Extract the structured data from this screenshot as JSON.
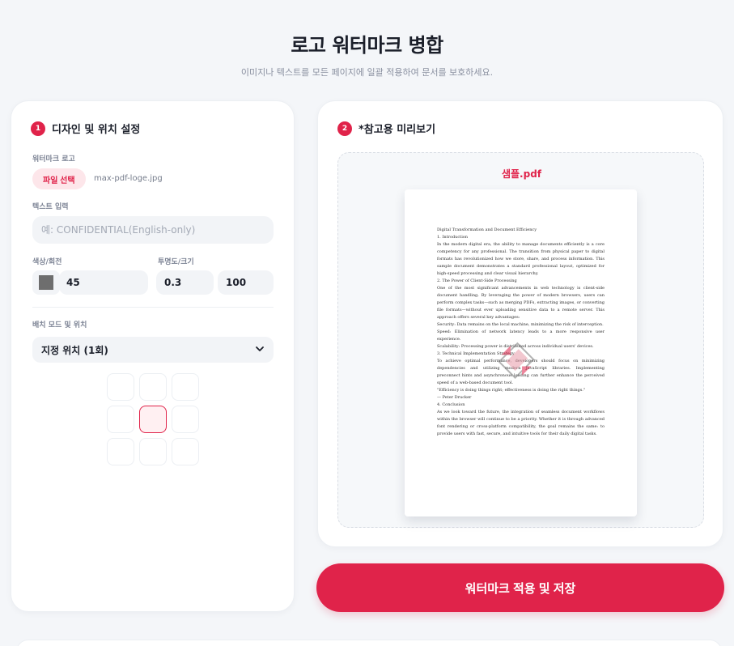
{
  "header": {
    "title": "로고 워터마크 병합",
    "subtitle": "이미지나 텍스트를 모든 페이지에 일괄 적용하여 문서를 보호하세요."
  },
  "design": {
    "step": "1",
    "title": "디자인 및 위치 설정",
    "logo_label": "워터마크 로고",
    "file_button": "파일 선택",
    "file_name": "max-pdf-loge.jpg",
    "text_label": "텍스트 입력",
    "text_placeholder": "예: CONFIDENTIAL(English-only)",
    "color_rotate_label": "색상/회전",
    "color": "#6e6e6e",
    "rotation": "45",
    "opacity_size_label": "투명도/크기",
    "opacity": "0.3",
    "size": "100",
    "placement_label": "배치 모드 및 위치",
    "placement_value": "지정 위치 (1회)",
    "selected_position": "center"
  },
  "preview": {
    "step": "2",
    "title": "*참고용 미리보기",
    "file_name": "샘플.pdf",
    "doc_lines": [
      "Digital Transformation and Document Efficiency",
      "1. Introduction",
      "In the modern digital era, the ability to manage documents efficiently is a core competency for any professional. The transition from physical paper to digital formats has revolutionized how we store, share, and process information. This sample document demonstrates a standard professional layout, optimized for high-speed processing and clear visual hierarchy.",
      "2. The Power of Client-Side Processing",
      "One of the most significant advancements in web technology is client-side document handling. By leveraging the power of modern browsers, users can perform complex tasks—such as merging PDFs, extracting images, or converting file formats—without ever uploading sensitive data to a remote server. This approach offers several key advantages:",
      "Security: Data remains on the local machine, minimizing the risk of interception.",
      "Speed: Elimination of network latency leads to a more responsive user experience.",
      "Scalability: Processing power is distributed across individual users' devices.",
      "3. Technical Implementation Strategy",
      "To achieve optimal performance, developers should focus on minimizing dependencies and utilizing modern JavaScript libraries. Implementing preconnect hints and asynchronous loading can further enhance the perceived speed of a web-based document tool.",
      "\"Efficiency is doing things right; effectiveness is doing the right things.\"",
      "— Peter Drucker",
      "4. Conclusion",
      "As we look toward the future, the integration of seamless document workflows within the browser will continue to be a priority. Whether it is through advanced font rendering or cross-platform compatibility, the goal remains the same: to provide users with fast, secure, and intuitive tools for their daily digital tasks."
    ]
  },
  "actions": {
    "apply_save": "워터마크 적용 및 저장"
  }
}
